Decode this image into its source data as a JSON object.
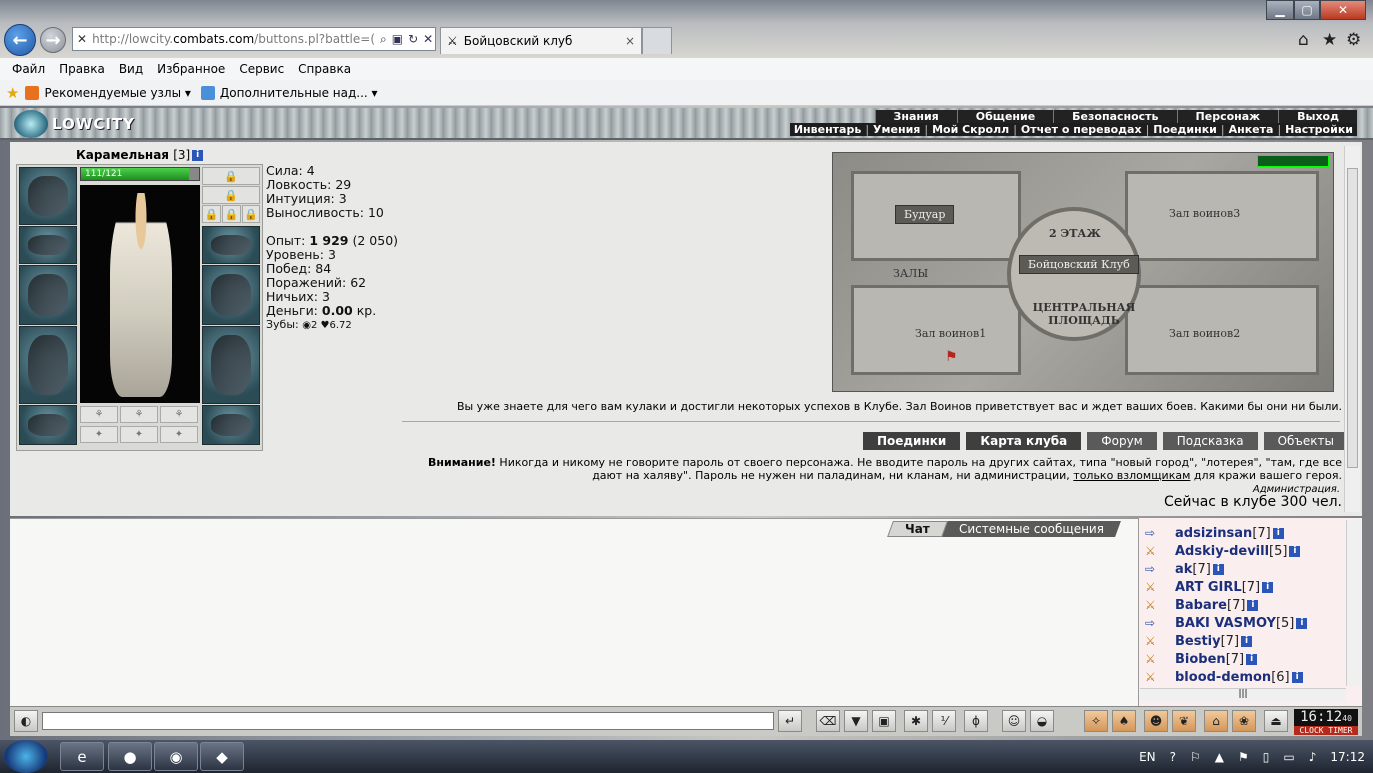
{
  "browser": {
    "url_muted": "http://lowcity.",
    "url_strong": "combats.com",
    "url_tail": "/buttons.pl?battle=(",
    "tab_title": "Бойцовский клуб",
    "tab_close": "×",
    "menu": [
      "Файл",
      "Правка",
      "Вид",
      "Избранное",
      "Сервис",
      "Справка"
    ],
    "favorites": [
      "Рекомендуемые узлы ▾",
      "Дополнительные над... ▾"
    ]
  },
  "game": {
    "logo": "LOWCITY",
    "top_nav": [
      "Знания",
      "Общение",
      "Безопасность",
      "Персонаж",
      "Выход"
    ],
    "sub_nav": [
      "Инвентарь",
      "Умения",
      "Мой Скролл",
      "Отчет о переводах",
      "Поединки",
      "Анкета",
      "Настройки"
    ],
    "character": {
      "name": "Карамельная",
      "level": "[3]",
      "hp": "111/121",
      "hp_fraction": 0.917
    },
    "stats": [
      {
        "label": "Сила:",
        "value": "4"
      },
      {
        "label": "Ловкость:",
        "value": "29"
      },
      {
        "label": "Интуиция:",
        "value": "3"
      },
      {
        "label": "Выносливость:",
        "value": "10"
      }
    ],
    "experience": {
      "label": "Опыт:",
      "value": "1 929",
      "next": "(2 050)"
    },
    "records": [
      {
        "label": "Уровень:",
        "value": "3"
      },
      {
        "label": "Побед:",
        "value": "84"
      },
      {
        "label": "Поражений:",
        "value": "62"
      },
      {
        "label": "Ничьих:",
        "value": "3"
      }
    ],
    "money": {
      "label": "Деньги:",
      "value": "0.00",
      "unit": "кр."
    },
    "teeth": {
      "label": "Зубы:",
      "value": "◉2 ♥6.72"
    },
    "map": {
      "boudoir": "Будуар",
      "hall3": "Зал воинов3",
      "floor": "2 ЭТАЖ",
      "club": "Бойцовский Клуб",
      "halls": "ЗАЛЫ",
      "square": "ЦЕНТРАЛЬНАЯ ПЛОЩАДЬ",
      "hall1": "Зал воинов1",
      "hall2": "Зал воинов2"
    },
    "welcome": "Вы уже знаете для чего вам кулаки и достигли некоторых успехов в Клубе. Зал Воинов приветствует вас и ждет ваших боев. Какими бы они ни были.",
    "actions": [
      "Поединки",
      "Карта клуба",
      "Форум",
      "Подсказка",
      "Объекты"
    ],
    "warning": {
      "bold": "Внимание!",
      "text": " Никогда и никому не говорите пароль от своего персонажа. Не вводите пароль на других сайтах, типа \"новый город\", \"лотерея\", \"там, где все дают на халяву\". Пароль не нужен ни паладинам, ни кланам, ни администрации, ",
      "link": "только взломщикам",
      "tail": " для кражи вашего героя."
    },
    "admin": "Администрация.",
    "online": "Сейчас в клубе 300 чел.",
    "chat_tabs": [
      "Чат",
      "Системные сообщения"
    ],
    "users": [
      {
        "nick": "adsizinsan",
        "level": "[7]"
      },
      {
        "nick": "Adskiy-devill",
        "level": "[5]"
      },
      {
        "nick": "ak",
        "level": "[7]"
      },
      {
        "nick": "ART GIRL",
        "level": "[7]"
      },
      {
        "nick": "Babare",
        "level": "[7]"
      },
      {
        "nick": "BAKI VASMOY",
        "level": "[5]"
      },
      {
        "nick": "Bestiy",
        "level": "[7]"
      },
      {
        "nick": "Bioben",
        "level": "[7]"
      },
      {
        "nick": "blood-demon",
        "level": "[6]"
      }
    ],
    "clock": "16:12",
    "clock_seconds": "40",
    "clock_label": "CLOCK TIMER"
  },
  "os": {
    "lang": "EN",
    "time": "17:12"
  }
}
